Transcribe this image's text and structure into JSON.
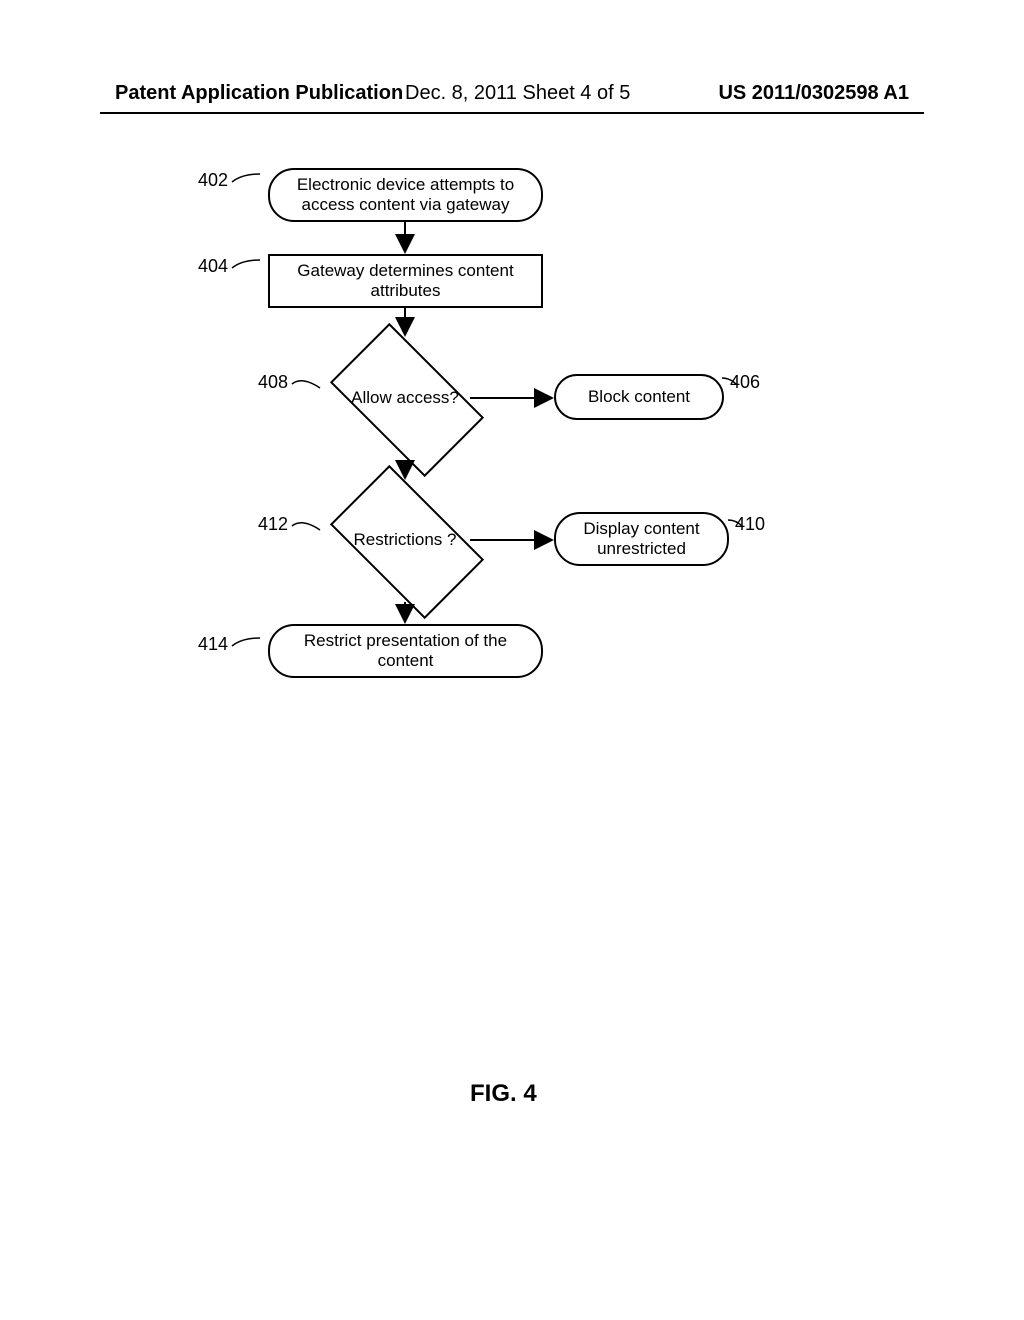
{
  "header": {
    "left": "Patent Application Publication",
    "mid": "Dec. 8, 2011   Sheet 4 of 5",
    "right": "US 2011/0302598 A1"
  },
  "nodes": {
    "n402": "Electronic device attempts to access content via gateway",
    "n404": "Gateway determines content attributes",
    "n408": "Allow access?",
    "n406": "Block content",
    "n412": "Restrictions ?",
    "n410": "Display content unrestricted",
    "n414": "Restrict presentation of the content"
  },
  "refs": {
    "r402": "402",
    "r404": "404",
    "r408": "408",
    "r406": "406",
    "r412": "412",
    "r410": "410",
    "r414": "414"
  },
  "figure_label": "FIG. 4"
}
